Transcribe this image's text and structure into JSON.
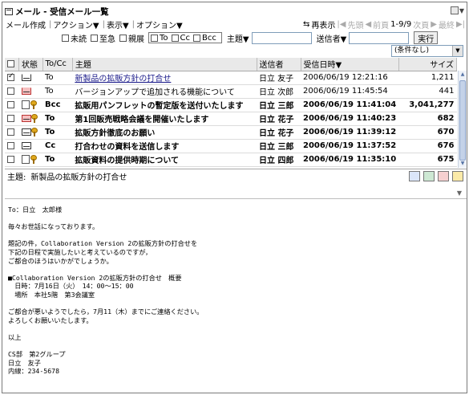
{
  "window": {
    "title": "メール - 受信メール一覧"
  },
  "menu": {
    "compose": "メール作成",
    "action": "アクション▼",
    "view": "表示▼",
    "option": "オプション▼",
    "refresh": "再表示",
    "first": "先頭",
    "prev": "前頁",
    "page": "1-9/9",
    "next": "次頁",
    "last": "最終"
  },
  "filters": {
    "unread": "未読",
    "urgent": "至急",
    "confidential": "親展",
    "to": "To",
    "cc": "Cc",
    "bcc": "Bcc",
    "subject_label": "主題▼",
    "subject_value": "",
    "sender_label": "送信者▼",
    "sender_value": "",
    "run": "実行",
    "condition": "(条件なし)"
  },
  "table": {
    "headers": {
      "status": "状態",
      "tocc": "To/Cc",
      "subject": "主題",
      "sender": "送信者",
      "date": "受信日時▼",
      "size": "サイズ"
    },
    "rows": [
      {
        "tocc": "To",
        "subject": "新製品の拡販方針の打合せ",
        "sender": "日立 友子",
        "date": "2006/06/19 12:21:16",
        "size": "1,211"
      },
      {
        "tocc": "To",
        "subject": "バージョンアップで追加される機能について",
        "sender": "日立 次郎",
        "date": "2006/06/19 11:45:54",
        "size": "441"
      },
      {
        "tocc": "Bcc",
        "subject": "拡販用パンフレットの暫定版を送付いたします",
        "sender": "日立 三郎",
        "date": "2006/06/19 11:41:04",
        "size": "3,041,277"
      },
      {
        "tocc": "To",
        "subject": "第1回販売戦略会議を開催いたします",
        "sender": "日立 花子",
        "date": "2006/06/19 11:40:23",
        "size": "682"
      },
      {
        "tocc": "To",
        "subject": "拡販方針徹底のお願い",
        "sender": "日立 花子",
        "date": "2006/06/19 11:39:12",
        "size": "670"
      },
      {
        "tocc": "Cc",
        "subject": "打合わせの資料を送信します",
        "sender": "日立 三郎",
        "date": "2006/06/19 11:37:52",
        "size": "676"
      },
      {
        "tocc": "To",
        "subject": "拡販資料の提供時期について",
        "sender": "日立 四郎",
        "date": "2006/06/19 11:35:10",
        "size": "675"
      }
    ]
  },
  "preview": {
    "subject_label": "主題:",
    "subject": "新製品の拡販方針の打合せ",
    "body": [
      "To：日立　太郎様",
      "",
      "毎々お世話になっております。",
      "",
      "題記の件，Collaboration Version 2の拡販方針の打合せを",
      "下記の日程で実施したいと考えているのですが，",
      "ご都合のほうはいかがでしょうか。",
      "",
      "■Collaboration Version 2の拡販方針の打合せ　概要",
      "　日時：7月16日（火）　14：00～15：00",
      "　場所　本社5階　第3会議室",
      "",
      "ご都合が悪いようでしたら，7月11（木）までにご連絡ください。",
      "よろしくお願いいたします。",
      "",
      "以上",
      "",
      "CS部　第2グループ",
      "日立　友子",
      "内線：234-5678"
    ]
  }
}
